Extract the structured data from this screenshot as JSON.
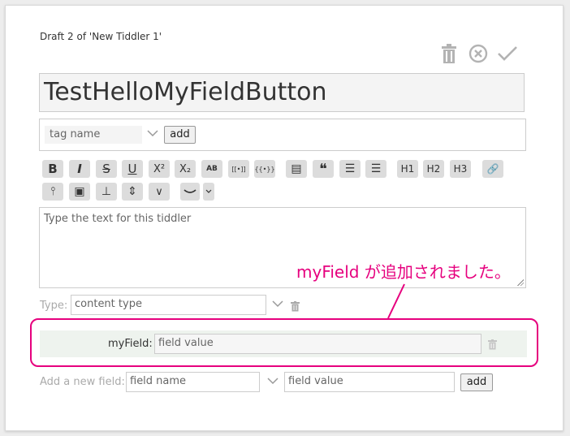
{
  "draft_title": "Draft 2 of 'New Tiddler 1'",
  "title_value": "TestHelloMyFieldButton",
  "tags": {
    "placeholder": "tag name",
    "add_label": "add"
  },
  "format_toolbar": {
    "row1": [
      {
        "name": "bold-button",
        "label": "B"
      },
      {
        "name": "italic-button",
        "label": "I"
      },
      {
        "name": "strikethrough-button",
        "label": "S"
      },
      {
        "name": "underline-button",
        "label": "U"
      },
      {
        "name": "superscript-button",
        "label": "X²"
      },
      {
        "name": "subscript-button",
        "label": "X₂"
      },
      {
        "name": "smallcaps-button",
        "label": "AB"
      },
      {
        "name": "transclude-button",
        "label": "[[•]]"
      },
      {
        "name": "macro-button",
        "label": "{{•}}"
      },
      {
        "name": "monospace-block-button",
        "label": "▤"
      },
      {
        "name": "quote-button",
        "label": "❝"
      },
      {
        "name": "bullet-list-button",
        "label": "☰"
      },
      {
        "name": "numbered-list-button",
        "label": "☰"
      },
      {
        "name": "heading1-button",
        "label": "H1"
      },
      {
        "name": "heading2-button",
        "label": "H2"
      },
      {
        "name": "heading3-button",
        "label": "H3"
      },
      {
        "name": "link-button",
        "label": "🔗"
      }
    ],
    "row2": [
      {
        "name": "excise-button",
        "label": "⫯"
      },
      {
        "name": "picture-button",
        "label": "▣"
      },
      {
        "name": "stamp-button",
        "label": "⊥"
      },
      {
        "name": "size-button",
        "label": "⇕"
      },
      {
        "name": "more-button",
        "label": "∨"
      }
    ]
  },
  "editor": {
    "placeholder": "Type the text for this tiddler"
  },
  "type_field": {
    "label": "Type:",
    "placeholder": "content type"
  },
  "custom_field": {
    "label": "myField:",
    "placeholder": "field value"
  },
  "new_field": {
    "label": "Add a new field:",
    "name_placeholder": "field name",
    "value_placeholder": "field value",
    "add_label": "add"
  },
  "annotation": {
    "text": "myField が追加されました。",
    "color": "#e6007e"
  },
  "colors": {
    "accent": "#e6007e",
    "icon_gray": "#b3b3b3"
  }
}
